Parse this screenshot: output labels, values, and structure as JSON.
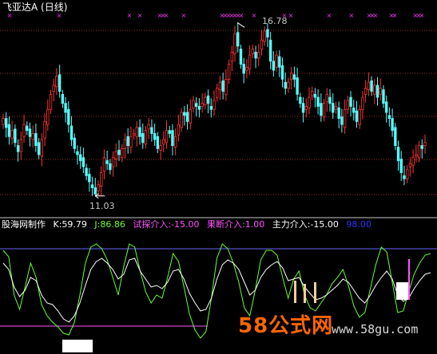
{
  "header": {
    "title": "飞亚达A (日线)",
    "title_color": "#ffffff"
  },
  "annotations": {
    "high_label": "16.78",
    "low_label": "11.03"
  },
  "indicator_bar": {
    "name": "股海网制作",
    "k_label": "K:59.79",
    "j_label": "J:86.86",
    "probe_label": "试探介入:-15.00",
    "decisive_label": "果断介入:1.00",
    "main_label": "主力介入:-15.00",
    "top_line_label": "98.00"
  },
  "watermark": {
    "site_name": "58公式网",
    "url": "www.58gu.com"
  },
  "colors": {
    "background": "#000000",
    "up_candle": "#ff3333",
    "down_candle": "#54ffff",
    "grid": "#a52a2a",
    "marker": "#ff33ff",
    "k_line": "#ffffff",
    "j_line": "#66ff33",
    "top_line": "#6666ff",
    "probe_color": "#ff55ff",
    "decisive_color": "#ff55ff",
    "main_color": "#ffffff",
    "name_color": "#ffffff",
    "k_color": "#ffffff",
    "j_color": "#66ff33",
    "main_text_color": "#ffffff",
    "top_text_color": "#3333ff",
    "bar_color": "#ffcc99"
  },
  "icons": [
    "cross-marker-icon",
    "arrow-left-icon"
  ],
  "chart_data": {
    "type": "candlestick",
    "high": 16.78,
    "low": 11.03,
    "closes": [
      13.6,
      13.3,
      13.0,
      13.2,
      12.8,
      12.5,
      12.9,
      13.4,
      13.2,
      13.0,
      13.1,
      12.7,
      12.4,
      12.9,
      13.5,
      13.9,
      14.4,
      14.7,
      15.0,
      14.5,
      14.1,
      13.8,
      13.4,
      12.9,
      12.6,
      12.4,
      12.2,
      12.0,
      11.7,
      11.5,
      11.3,
      11.1,
      11.4,
      11.8,
      12.3,
      12.1,
      11.9,
      12.3,
      12.5,
      12.4,
      12.6,
      12.9,
      12.7,
      13.0,
      13.1,
      13.3,
      13.0,
      12.8,
      13.2,
      13.4,
      13.1,
      12.9,
      12.6,
      12.7,
      12.9,
      13.2,
      13.1,
      12.7,
      13.0,
      13.4,
      13.8,
      13.7,
      13.5,
      13.9,
      14.2,
      14.0,
      13.9,
      14.1,
      14.3,
      14.1,
      13.9,
      14.2,
      14.6,
      14.8,
      14.5,
      14.9,
      15.4,
      15.8,
      16.4,
      16.0,
      15.4,
      15.1,
      15.3,
      15.7,
      15.9,
      15.6,
      15.8,
      16.2,
      16.5,
      16.3,
      15.5,
      15.2,
      15.7,
      15.3,
      14.9,
      14.6,
      14.8,
      15.1,
      14.9,
      14.4,
      14.1,
      13.8,
      14.0,
      14.3,
      14.5,
      14.3,
      14.0,
      13.7,
      14.1,
      14.4,
      14.1,
      13.8,
      14.0,
      13.6,
      13.4,
      13.9,
      14.2,
      14.0,
      13.8,
      13.5,
      13.9,
      14.3,
      14.6,
      14.8,
      14.5,
      14.7,
      14.3,
      14.6,
      14.1,
      13.8,
      13.6,
      13.2,
      12.7,
      12.2,
      11.8,
      11.6,
      11.9,
      12.1,
      12.3,
      12.4,
      12.7,
      12.6,
      12.8
    ],
    "markers_x": [
      12,
      74,
      162,
      175,
      200,
      204,
      208,
      230,
      278,
      282,
      286,
      290,
      294,
      298,
      302,
      318,
      356,
      364,
      412,
      440,
      462,
      466,
      470,
      490,
      494,
      520,
      524,
      528
    ],
    "indicator": {
      "k_values": [
        80,
        72,
        50,
        38,
        46,
        62,
        58,
        40,
        30,
        28,
        20,
        10,
        6,
        14,
        30,
        52,
        72,
        82,
        86,
        80,
        72,
        60,
        66,
        84,
        86,
        70,
        60,
        50,
        52,
        48,
        56,
        70,
        72,
        60,
        42,
        30,
        20,
        22,
        36,
        60,
        78,
        84,
        80,
        72,
        56,
        40,
        46,
        62,
        72,
        78,
        82,
        74,
        58,
        60,
        62,
        50,
        42,
        34,
        36,
        40,
        46,
        52,
        60,
        56,
        46,
        36,
        30,
        40,
        52,
        62,
        70,
        60,
        40,
        32,
        36,
        48,
        58,
        66,
        68
      ],
      "j_values": [
        96,
        88,
        40,
        22,
        50,
        80,
        62,
        28,
        14,
        6,
        0,
        -8,
        -10,
        6,
        40,
        80,
        100,
        104,
        98,
        84,
        62,
        40,
        76,
        104,
        100,
        70,
        44,
        30,
        40,
        36,
        62,
        92,
        82,
        50,
        16,
        -4,
        -14,
        -6,
        36,
        86,
        104,
        98,
        80,
        56,
        24,
        14,
        46,
        84,
        96,
        96,
        90,
        62,
        36,
        60,
        70,
        40,
        24,
        20,
        30,
        40,
        54,
        62,
        72,
        52,
        26,
        12,
        18,
        48,
        78,
        100,
        94,
        56,
        18,
        20,
        44,
        66,
        80,
        90,
        92
      ],
      "top_line": 98.0,
      "probe_level": -15.0,
      "decisive_level": 1.0,
      "main_level": -15.0
    }
  }
}
